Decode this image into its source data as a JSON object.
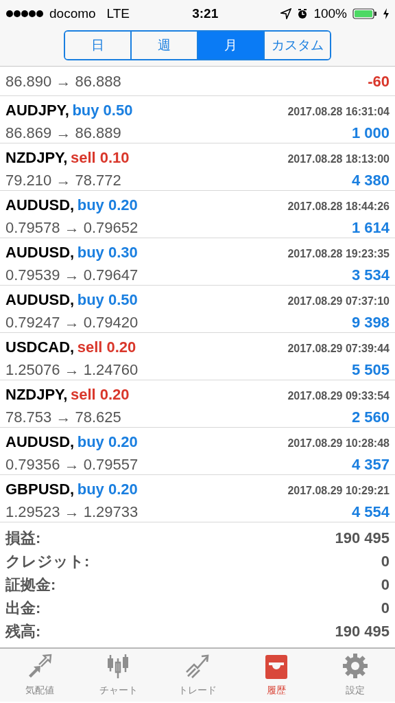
{
  "status_bar": {
    "carrier": "docomo",
    "network": "LTE",
    "time": "3:21",
    "battery": "100%"
  },
  "segments": [
    {
      "label": "日",
      "selected": false
    },
    {
      "label": "週",
      "selected": false
    },
    {
      "label": "月",
      "selected": true
    },
    {
      "label": "カスタム",
      "selected": false
    }
  ],
  "partial_row": {
    "prices": "86.890 → 86.888",
    "profit": "-60",
    "negative": true
  },
  "trades": [
    {
      "symbol": "AUDJPY,",
      "side": "buy 0.50",
      "kind": "buy",
      "time": "2017.08.28 16:31:04",
      "prices": "86.869 → 86.889",
      "profit": "1 000",
      "negative": false
    },
    {
      "symbol": "NZDJPY,",
      "side": "sell 0.10",
      "kind": "sell",
      "time": "2017.08.28 18:13:00",
      "prices": "79.210 → 78.772",
      "profit": "4 380",
      "negative": false
    },
    {
      "symbol": "AUDUSD,",
      "side": "buy 0.20",
      "kind": "buy",
      "time": "2017.08.28 18:44:26",
      "prices": "0.79578 → 0.79652",
      "profit": "1 614",
      "negative": false
    },
    {
      "symbol": "AUDUSD,",
      "side": "buy 0.30",
      "kind": "buy",
      "time": "2017.08.28 19:23:35",
      "prices": "0.79539 → 0.79647",
      "profit": "3 534",
      "negative": false
    },
    {
      "symbol": "AUDUSD,",
      "side": "buy 0.50",
      "kind": "buy",
      "time": "2017.08.29 07:37:10",
      "prices": "0.79247 → 0.79420",
      "profit": "9 398",
      "negative": false
    },
    {
      "symbol": "USDCAD,",
      "side": "sell 0.20",
      "kind": "sell",
      "time": "2017.08.29 07:39:44",
      "prices": "1.25076 → 1.24760",
      "profit": "5 505",
      "negative": false
    },
    {
      "symbol": "NZDJPY,",
      "side": "sell 0.20",
      "kind": "sell",
      "time": "2017.08.29 09:33:54",
      "prices": "78.753 → 78.625",
      "profit": "2 560",
      "negative": false
    },
    {
      "symbol": "AUDUSD,",
      "side": "buy 0.20",
      "kind": "buy",
      "time": "2017.08.29 10:28:48",
      "prices": "0.79356 → 0.79557",
      "profit": "4 357",
      "negative": false
    },
    {
      "symbol": "GBPUSD,",
      "side": "buy 0.20",
      "kind": "buy",
      "time": "2017.08.29 10:29:21",
      "prices": "1.29523 → 1.29733",
      "profit": "4 554",
      "negative": false
    }
  ],
  "summary": [
    {
      "label": "損益:",
      "value": "190 495"
    },
    {
      "label": "クレジット:",
      "value": "0"
    },
    {
      "label": "証拠金:",
      "value": "0"
    },
    {
      "label": "出金:",
      "value": "0"
    },
    {
      "label": "残高:",
      "value": "190 495"
    }
  ],
  "tab_bar": [
    {
      "kind": "quotes",
      "label": "気配値",
      "selected": false
    },
    {
      "kind": "chart",
      "label": "チャート",
      "selected": false
    },
    {
      "kind": "trade",
      "label": "トレード",
      "selected": false
    },
    {
      "kind": "history",
      "label": "履歴",
      "selected": true
    },
    {
      "kind": "settings",
      "label": "設定",
      "selected": false
    }
  ]
}
